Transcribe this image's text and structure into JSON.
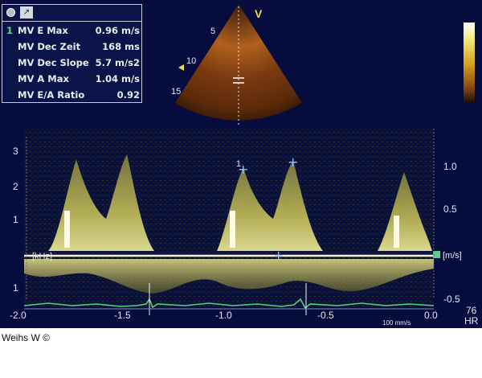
{
  "toolbar": {
    "record_icon": "record-dot-icon",
    "cursor_icon": "cursor-icon"
  },
  "measurements": [
    {
      "index": "1",
      "label": "MV E Max",
      "value": "0.96 m/s"
    },
    {
      "index": "",
      "label": "MV Dec Zeit",
      "value": "168 ms"
    },
    {
      "index": "",
      "label": "MV Dec Slope",
      "value": "5.7 m/s2"
    },
    {
      "index": "",
      "label": "MV A Max",
      "value": "1.04 m/s"
    },
    {
      "index": "",
      "label": "MV E/A Ratio",
      "value": "0.92"
    }
  ],
  "image_2d": {
    "orientation_marker": "V",
    "depth_labels": [
      "5",
      "10",
      "15"
    ]
  },
  "doppler": {
    "left_scale_unit": "[kHz]",
    "left_scale_ticks_up": [
      "3",
      "2",
      "1"
    ],
    "left_scale_ticks_down": [
      "1"
    ],
    "right_scale_unit": "[m/s]",
    "right_scale_ticks": [
      "1.0",
      "0.5",
      "-0.5"
    ],
    "time_ticks": [
      "-2.0",
      "-1.5",
      "-1.0",
      "-0.5",
      "0.0"
    ],
    "sweep_speed": "100 mm/s",
    "heart_rate_value": "76",
    "heart_rate_label": "HR",
    "caliper_label": "1"
  },
  "credit": "Weihs W ©"
}
